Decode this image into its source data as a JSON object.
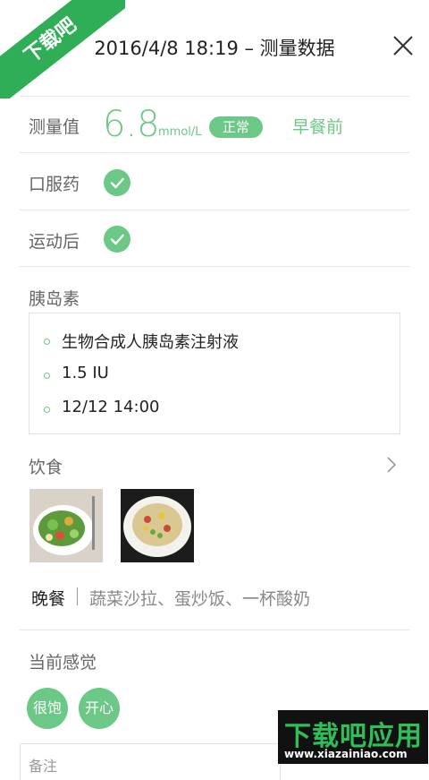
{
  "watermark": {
    "ribbon_text": "下载吧"
  },
  "header": {
    "title": "2016/4/8  18:19 – 测量数据"
  },
  "reading": {
    "label": "测量值",
    "value": "6.8",
    "unit": "mmol/L",
    "status": "正常",
    "meal_time": "早餐前"
  },
  "medication": {
    "label": "口服药",
    "checked": true
  },
  "exercise": {
    "label": "运动后",
    "checked": true
  },
  "insulin": {
    "label": "胰岛素",
    "items": [
      "生物合成人胰岛素注射液",
      "1.5 IU",
      "12/12  14:00"
    ]
  },
  "diet": {
    "label": "饮食",
    "photos": [
      "salad-photo",
      "fried-rice-photo"
    ],
    "meal_name": "晚餐",
    "meal_items": "蔬菜沙拉、蛋炒饭、一杯酸奶"
  },
  "feeling": {
    "label": "当前感觉",
    "chips": [
      "很饱",
      "开心"
    ]
  },
  "note": {
    "label": "备注"
  },
  "brand": {
    "main": "下载吧应用",
    "url": "www.xiazainiao.com"
  },
  "colors": {
    "accent": "#6cc886",
    "ribbon": "#2fae57",
    "divider": "#e6e6e6"
  }
}
